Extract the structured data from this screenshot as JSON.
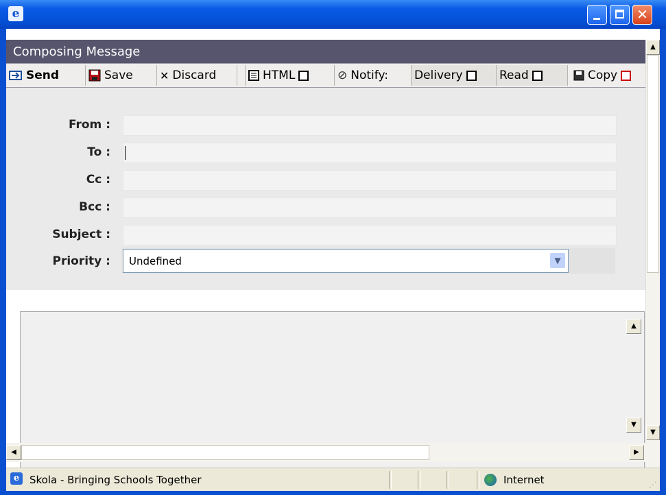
{
  "window": {
    "app_icon_glyph": "e"
  },
  "header": {
    "title": "Composing Message"
  },
  "toolbar": {
    "send": "Send",
    "save": "Save",
    "discard": "Discard",
    "html": "HTML",
    "notify": "Notify:",
    "delivery": "Delivery",
    "read": "Read",
    "copy": "Copy"
  },
  "form": {
    "from_label": "From :",
    "to_label": "To :",
    "cc_label": "Cc :",
    "bcc_label": "Bcc :",
    "subject_label": "Subject :",
    "priority_label": "Priority :",
    "priority_value": "Undefined"
  },
  "status_bar": {
    "text": "Skola - Bringing Schools Together",
    "zone": "Internet"
  },
  "icons": [
    "app-icon",
    "minimize-icon",
    "maximize-icon",
    "close-icon",
    "send-icon",
    "save-icon",
    "discard-icon",
    "html-icon",
    "notify-icon",
    "copy-icon",
    "globe-icon"
  ]
}
